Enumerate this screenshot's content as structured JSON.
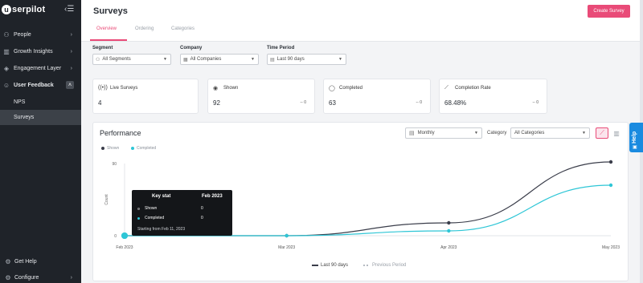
{
  "brand": {
    "logo_letter": "u",
    "logo_text": "serpilot"
  },
  "sidebar": {
    "collapse_icon": "collapse-menu-icon",
    "items": [
      {
        "label": "People",
        "icon": "people-icon"
      },
      {
        "label": "Growth Insights",
        "icon": "bar-chart-icon"
      },
      {
        "label": "Engagement Layer",
        "icon": "layers-icon"
      },
      {
        "label": "User Feedback",
        "icon": "smiley-icon",
        "expanded": true
      }
    ],
    "sub_items": [
      {
        "label": "NPS",
        "active": false
      },
      {
        "label": "Surveys",
        "active": true
      }
    ],
    "bottom": [
      {
        "label": "Get Help",
        "icon": "gear-icon"
      },
      {
        "label": "Configure",
        "icon": "gear-icon"
      }
    ]
  },
  "header": {
    "title": "Surveys",
    "create_button": "Create Survey",
    "tabs": [
      {
        "label": "Overview",
        "active": true
      },
      {
        "label": "Ordering",
        "active": false
      },
      {
        "label": "Categories",
        "active": false
      }
    ]
  },
  "filters": {
    "segment": {
      "label": "Segment",
      "value": "All Segments"
    },
    "company": {
      "label": "Company",
      "value": "All Companies"
    },
    "time_period": {
      "label": "Time Period",
      "value": "Last 90 days"
    }
  },
  "stats": [
    {
      "label": "Live Surveys",
      "value": "4",
      "icon": "broadcast-icon",
      "delta": ""
    },
    {
      "label": "Shown",
      "value": "92",
      "icon": "eye-icon",
      "delta": "-- 0"
    },
    {
      "label": "Completed",
      "value": "63",
      "icon": "chat-bubble-icon",
      "delta": "-- 0"
    },
    {
      "label": "Completion Rate",
      "value": "68.48%",
      "icon": "trend-icon",
      "delta": "-- 0"
    }
  ],
  "performance": {
    "title": "Performance",
    "interval": "Monthly",
    "category_label": "Category",
    "category_value": "All Categories",
    "legend_top": [
      "Shown",
      "Completed"
    ],
    "legend_bottom": [
      "Last 90 days",
      "Previous Period"
    ]
  },
  "tooltip": {
    "header_left": "Key stat",
    "header_right": "Feb 2023",
    "rows": [
      {
        "label": "Shown",
        "value": "0"
      },
      {
        "label": "Completed",
        "value": "0"
      }
    ],
    "footer": "Starting from Feb 11, 2023"
  },
  "help": {
    "label": "Help"
  },
  "colors": {
    "accent": "#e94b78",
    "shown": "#3a3d4a",
    "completed": "#2ec6d6",
    "sidebar": "#1f2329",
    "help": "#1a8be0"
  },
  "chart_data": {
    "type": "line",
    "x": [
      "Feb 2023",
      "Mar 2023",
      "Apr 2023",
      "May 2023"
    ],
    "series": [
      {
        "name": "Shown",
        "values": [
          0,
          0,
          16,
          92
        ]
      },
      {
        "name": "Completed",
        "values": [
          0,
          0,
          6,
          63
        ]
      }
    ],
    "ylabel": "Count",
    "yticks": [
      "0",
      "90"
    ],
    "ylim": [
      0,
      90
    ],
    "legend": "top-left",
    "grid": false
  }
}
